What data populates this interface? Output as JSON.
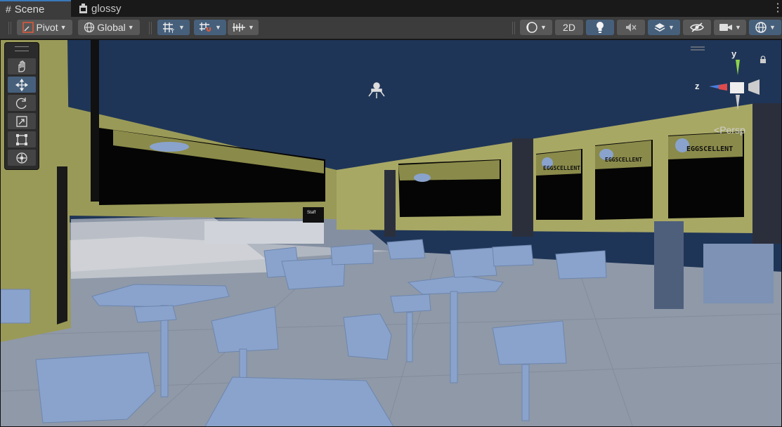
{
  "tabs": [
    {
      "label": "Scene",
      "icon": "grid-hash-icon"
    },
    {
      "label": "glossy",
      "icon": "prefab-icon"
    }
  ],
  "toolbar": {
    "pivot_label": "Pivot",
    "global_label": "Global",
    "mode_2d_label": "2D"
  },
  "scene": {
    "camera_mode": "Persp",
    "axis_y": "y",
    "axis_z": "z",
    "signs": [
      "EGGSCELLENT",
      "EGGSCELLENT",
      "EGGSCELLENT"
    ],
    "door_sign": "Staff"
  },
  "colors": {
    "sky": "#1f3557",
    "wall": "#9a9a58",
    "floor": "#8f99a8",
    "furniture": "#8aa3cc",
    "accent": "#3a79bb"
  }
}
